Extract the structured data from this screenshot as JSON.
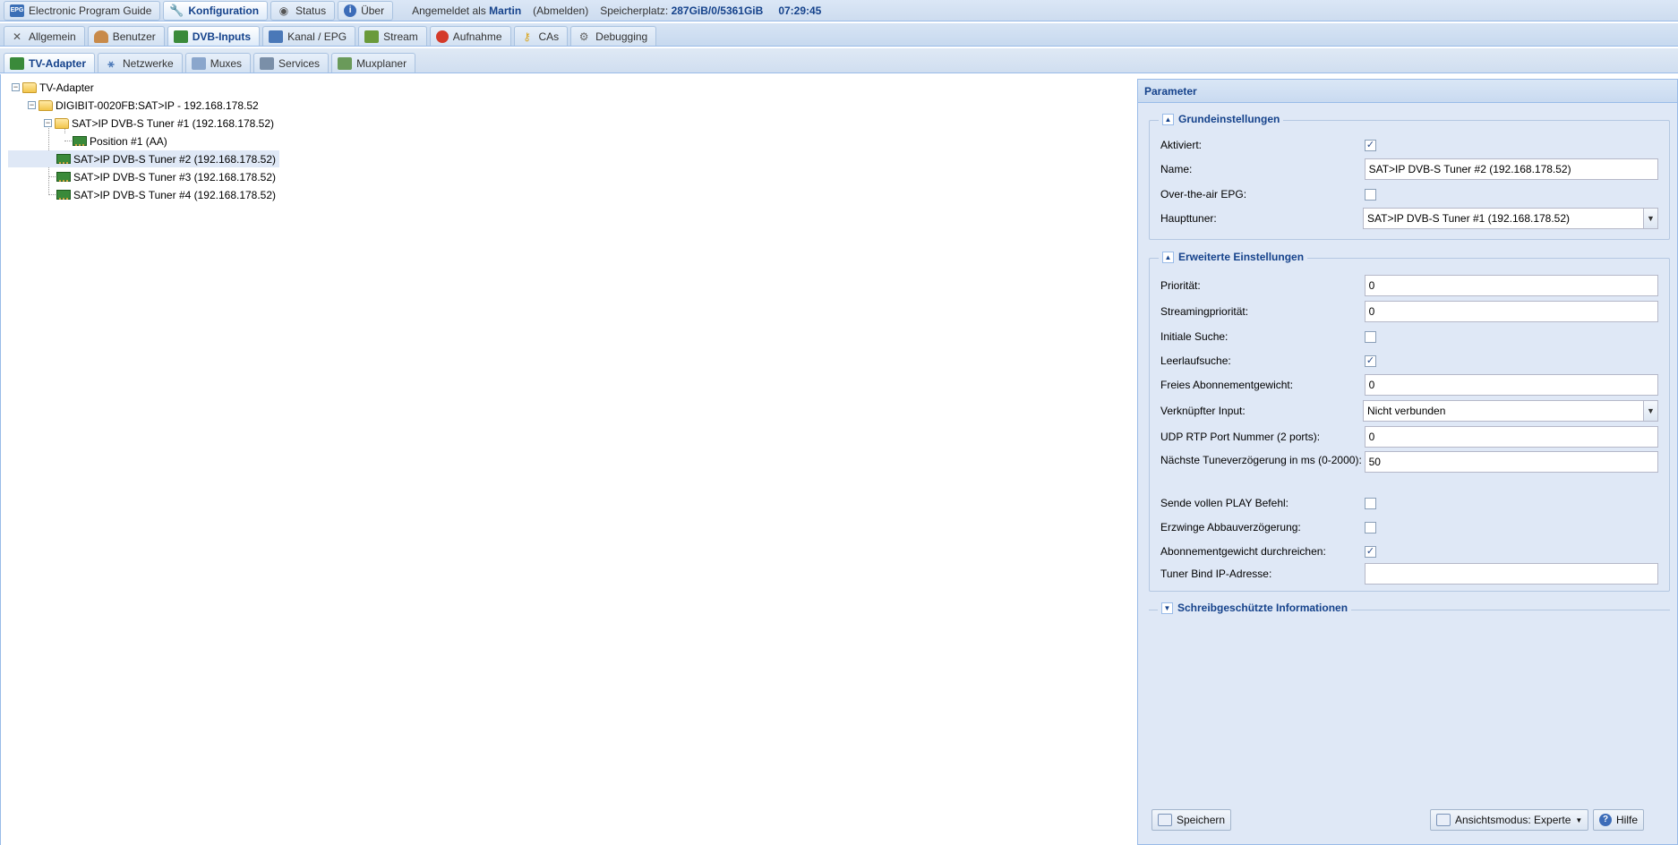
{
  "topbar": {
    "tabs": [
      {
        "label": "Electronic Program Guide",
        "icon": "epg-icon"
      },
      {
        "label": "Konfiguration",
        "icon": "wrench-icon",
        "active": true
      },
      {
        "label": "Status",
        "icon": "eye-icon"
      },
      {
        "label": "Über",
        "icon": "info-icon"
      }
    ],
    "logged_in_prefix": "Angemeldet als",
    "user": "Martin",
    "logout": "(Abmelden)",
    "storage_label": "Speicherplatz:",
    "storage_value": "287GiB/0/5361GiB",
    "clock": "07:29:45"
  },
  "config_tabs": [
    {
      "label": "Allgemein",
      "icon": "tools-icon"
    },
    {
      "label": "Benutzer",
      "icon": "users-icon"
    },
    {
      "label": "DVB-Inputs",
      "icon": "dvb-card-icon",
      "active": true
    },
    {
      "label": "Kanal / EPG",
      "icon": "tv-icon"
    },
    {
      "label": "Stream",
      "icon": "stream-icon"
    },
    {
      "label": "Aufnahme",
      "icon": "record-icon"
    },
    {
      "label": "CAs",
      "icon": "key-icon"
    },
    {
      "label": "Debugging",
      "icon": "bug-icon"
    }
  ],
  "dvb_tabs": [
    {
      "label": "TV-Adapter",
      "icon": "adapter-icon",
      "active": true
    },
    {
      "label": "Netzwerke",
      "icon": "network-icon"
    },
    {
      "label": "Muxes",
      "icon": "mux-icon"
    },
    {
      "label": "Services",
      "icon": "services-icon"
    },
    {
      "label": "Muxplaner",
      "icon": "scheduler-icon"
    }
  ],
  "tree": {
    "root": "TV-Adapter",
    "device": "DIGIBIT-0020FB:SAT>IP - 192.168.178.52",
    "tuner1": "SAT>IP DVB-S Tuner #1 (192.168.178.52)",
    "position1": "Position #1 (AA)",
    "tuner2": "SAT>IP DVB-S Tuner #2 (192.168.178.52)",
    "tuner3": "SAT>IP DVB-S Tuner #3 (192.168.178.52)",
    "tuner4": "SAT>IP DVB-S Tuner #4 (192.168.178.52)"
  },
  "param": {
    "title": "Parameter",
    "basic": {
      "legend": "Grundeinstellungen",
      "aktiviert_label": "Aktiviert:",
      "aktiviert": true,
      "name_label": "Name:",
      "name_value": "SAT>IP DVB-S Tuner #2 (192.168.178.52)",
      "epg_label": "Over-the-air EPG:",
      "epg": false,
      "haupttuner_label": "Haupttuner:",
      "haupttuner_value": "SAT>IP DVB-S Tuner #1 (192.168.178.52)"
    },
    "advanced": {
      "legend": "Erweiterte Einstellungen",
      "prioritaet_label": "Priorität:",
      "prioritaet_value": "0",
      "stream_prio_label": "Streamingpriorität:",
      "stream_prio_value": "0",
      "initiale_label": "Initiale Suche:",
      "initiale": false,
      "leerlauf_label": "Leerlaufsuche:",
      "leerlauf": true,
      "abo_gewicht_label": "Freies Abonnementgewicht:",
      "abo_gewicht_value": "0",
      "verknuepft_label": "Verknüpfter Input:",
      "verknuepft_value": "Nicht verbunden",
      "udp_label": "UDP RTP Port Nummer (2 ports):",
      "udp_value": "0",
      "tune_delay_label": "Nächste Tuneverzögerung in ms (0-2000):",
      "tune_delay_value": "50",
      "play_label": "Sende vollen PLAY Befehl:",
      "play": false,
      "abbau_label": "Erzwinge Abbauverzögerung:",
      "abbau": false,
      "durchreichen_label": "Abonnementgewicht durchreichen:",
      "durchreichen": true,
      "bind_label": "Tuner Bind IP-Adresse:",
      "bind_value": ""
    },
    "readonly_legend": "Schreibgeschützte Informationen",
    "save_label": "Speichern",
    "view_mode_label": "Ansichtsmodus: Experte",
    "help_label": "Hilfe"
  }
}
